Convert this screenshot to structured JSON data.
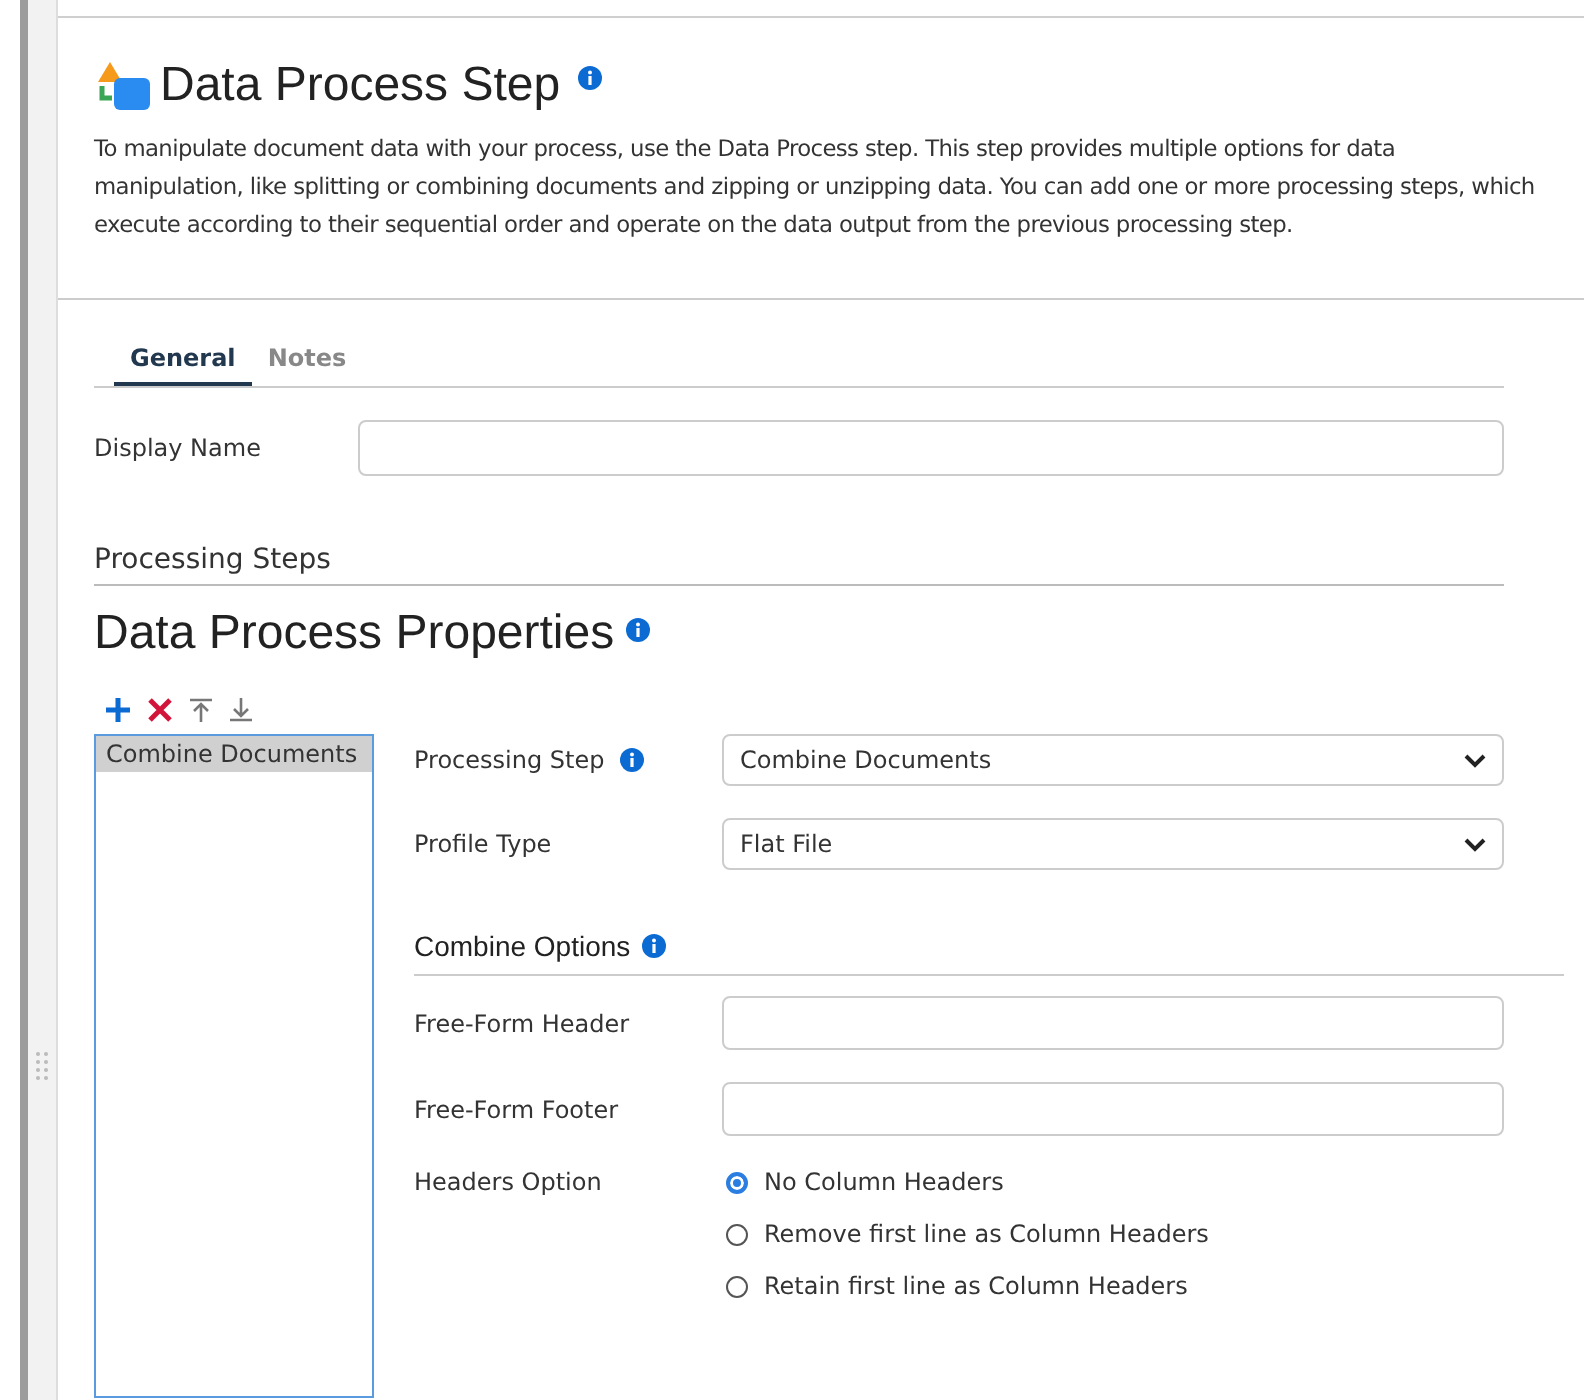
{
  "header": {
    "title": "Data Process Step",
    "description": "To manipulate document data with your process, use the Data Process step. This step provides multiple options for data manipulation, like splitting or combining documents and zipping or unzipping data. You can add one or more processing steps, which execute according to their sequential order and operate on the data output from the previous processing step."
  },
  "tabs": [
    {
      "label": "General",
      "selected": true
    },
    {
      "label": "Notes",
      "selected": false
    }
  ],
  "display_name": {
    "label": "Display Name"
  },
  "processing_steps_label": "Processing Steps",
  "properties_title": "Data Process Properties",
  "steps": [
    {
      "label": "Combine Documents",
      "selected": true
    }
  ],
  "form": {
    "processing_step": {
      "label": "Processing Step",
      "value": "Combine Documents"
    },
    "profile_type": {
      "label": "Profile Type",
      "value": "Flat File"
    },
    "combine_options_title": "Combine Options",
    "free_form_header": {
      "label": "Free-Form Header"
    },
    "free_form_footer": {
      "label": "Free-Form Footer"
    },
    "headers_option": {
      "label": "Headers Option",
      "options": [
        {
          "label": "No Column Headers",
          "selected": true
        },
        {
          "label": "Remove first line as Column Headers",
          "selected": false
        },
        {
          "label": "Retain first line as Column Headers",
          "selected": false
        }
      ]
    }
  }
}
